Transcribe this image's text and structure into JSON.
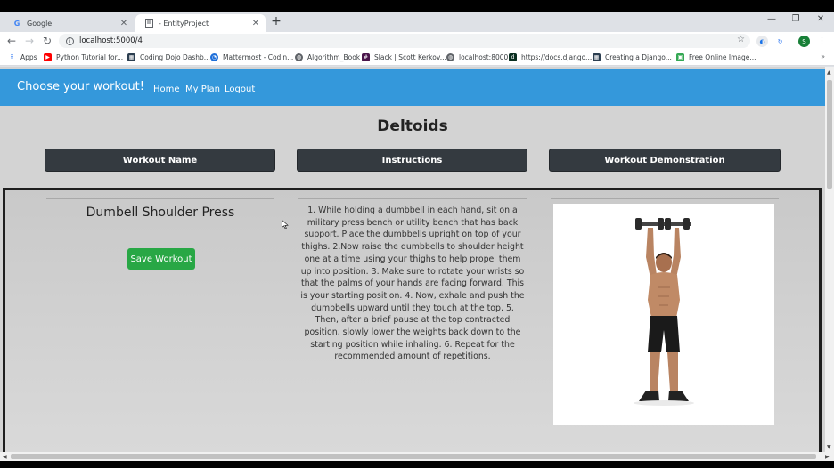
{
  "browser": {
    "tabs": [
      {
        "title": "Google",
        "favicon": "google-icon"
      },
      {
        "title": "- EntityProject",
        "favicon": "page-icon"
      }
    ],
    "url": "localhost:5000/4",
    "profile_initial": "S",
    "bookmarks": [
      {
        "label": "Apps",
        "icon": "apps-icon",
        "color": "#4285f4"
      },
      {
        "label": "Python Tutorial for...",
        "icon": "youtube-icon",
        "color": "#ff0000"
      },
      {
        "label": "Coding Dojo Dashb...",
        "icon": "dojo-icon",
        "color": "#2c3e50"
      },
      {
        "label": "Mattermost - Codin...",
        "icon": "mattermost-icon",
        "color": "#1e6fd9"
      },
      {
        "label": "Algorithm_Book",
        "icon": "globe-icon",
        "color": "#5f6368"
      },
      {
        "label": "Slack | Scott Kerkov...",
        "icon": "slack-icon",
        "color": "#4a154b"
      },
      {
        "label": "localhost:8000",
        "icon": "globe-icon",
        "color": "#5f6368"
      },
      {
        "label": "https://docs.django...",
        "icon": "django-icon",
        "color": "#092e20"
      },
      {
        "label": "Creating a Django...",
        "icon": "dojo-icon",
        "color": "#2c3e50"
      },
      {
        "label": "Free Online Image...",
        "icon": "image-icon",
        "color": "#34a853"
      }
    ]
  },
  "navbar": {
    "brand": "Choose your workout!",
    "links": [
      "Home",
      "My Plan",
      "Logout"
    ],
    "color": "#3498db"
  },
  "page": {
    "heading": "Deltoids",
    "column_headers": [
      "Workout Name",
      "Instructions",
      "Workout Demonstration"
    ],
    "exercise_name": "Dumbell Shoulder Press",
    "save_label": "Save Workout",
    "instructions": "1. While holding a dumbbell in each hand, sit on a military press bench or utility bench that has back support. Place the dumbbells upright on top of your thighs. 2.Now raise the dumbbells to shoulder height one at a time using your thighs to help propel them up into position. 3. Make sure to rotate your wrists so that the palms of your hands are facing forward. This is your starting position. 4. Now, exhale and push the dumbbells upward until they touch at the top. 5. Then, after a brief pause at the top contracted position, slowly lower the weights back down to the starting position while inhaling. 6. Repeat for the recommended amount of repetitions.",
    "demo_image": "man-overhead-dumbbell-press-image"
  }
}
